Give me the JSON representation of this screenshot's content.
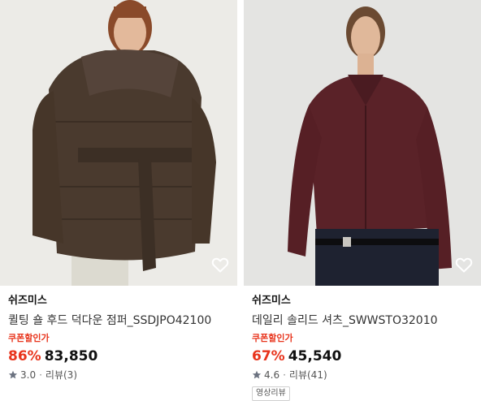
{
  "products": [
    {
      "brand": "쉬즈미스",
      "name": "퀼팅 숄 후드 덕다운 점퍼_SSDJPO42100",
      "coupon_label": "쿠폰할인가",
      "discount": "86%",
      "price": "83,850",
      "rating": "3.0",
      "review_label": "리뷰(3)",
      "icons": {
        "wishlist": "heart-outline-icon",
        "rating": "star-icon"
      }
    },
    {
      "brand": "쉬즈미스",
      "name": "데일리 솔리드 셔츠_SWWSTO32010",
      "coupon_label": "쿠폰할인가",
      "discount": "67%",
      "price": "45,540",
      "rating": "4.6",
      "review_label": "리뷰(41)",
      "tag": "영상리뷰",
      "icons": {
        "wishlist": "heart-outline-icon",
        "rating": "star-icon"
      }
    }
  ],
  "colors": {
    "discount": "#e8341c",
    "coupon": "#e8341c",
    "price": "#111111",
    "star": "#6b7280"
  }
}
